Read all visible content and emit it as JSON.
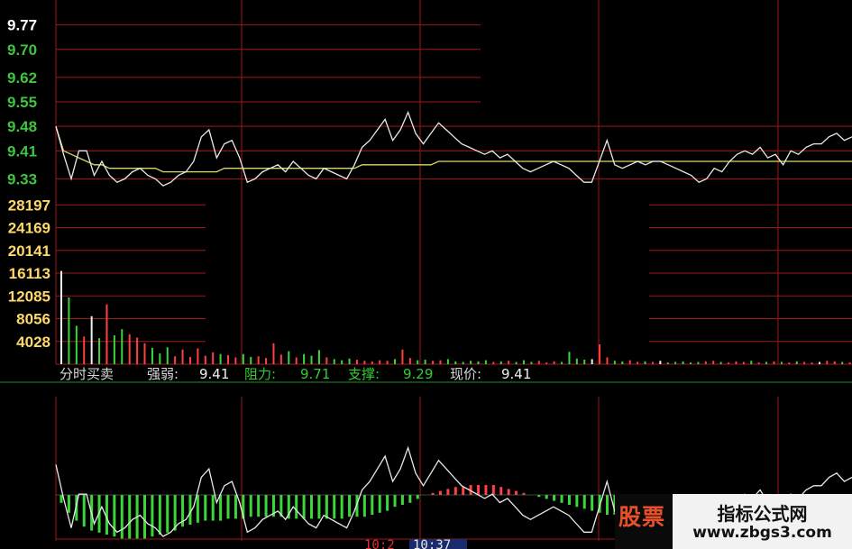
{
  "chart_data": {
    "type": "line",
    "price_panel": {
      "ticks": [
        "9.77",
        "9.70",
        "9.62",
        "9.55",
        "9.48",
        "9.41",
        "9.33"
      ],
      "tick_values": [
        9.77,
        9.7,
        9.62,
        9.55,
        9.48,
        9.41,
        9.33
      ],
      "ylim": [
        9.3,
        9.8
      ],
      "price": [
        9.48,
        9.4,
        9.33,
        9.41,
        9.41,
        9.34,
        9.38,
        9.34,
        9.32,
        9.33,
        9.35,
        9.36,
        9.34,
        9.33,
        9.31,
        9.32,
        9.34,
        9.35,
        9.38,
        9.45,
        9.47,
        9.39,
        9.43,
        9.44,
        9.39,
        9.32,
        9.33,
        9.35,
        9.36,
        9.37,
        9.35,
        9.38,
        9.36,
        9.34,
        9.33,
        9.36,
        9.35,
        9.34,
        9.33,
        9.37,
        9.42,
        9.44,
        9.47,
        9.5,
        9.44,
        9.47,
        9.52,
        9.46,
        9.43,
        9.46,
        9.49,
        9.47,
        9.45,
        9.43,
        9.42,
        9.41,
        9.4,
        9.41,
        9.39,
        9.4,
        9.38,
        9.36,
        9.35,
        9.36,
        9.37,
        9.38,
        9.37,
        9.36,
        9.34,
        9.32,
        9.32,
        9.38,
        9.44,
        9.37,
        9.36,
        9.37,
        9.38,
        9.37,
        9.38,
        9.38,
        9.37,
        9.36,
        9.35,
        9.34,
        9.32,
        9.33,
        9.36,
        9.35,
        9.38,
        9.4,
        9.41,
        9.4,
        9.42,
        9.39,
        9.4,
        9.37,
        9.41,
        9.4,
        9.42,
        9.43,
        9.43,
        9.45,
        9.46,
        9.44,
        9.45
      ],
      "avg": [
        9.48,
        9.41,
        9.4,
        9.39,
        9.38,
        9.37,
        9.37,
        9.36,
        9.36,
        9.36,
        9.36,
        9.36,
        9.36,
        9.36,
        9.35,
        9.35,
        9.35,
        9.35,
        9.35,
        9.35,
        9.35,
        9.35,
        9.36,
        9.36,
        9.36,
        9.36,
        9.36,
        9.36,
        9.36,
        9.36,
        9.36,
        9.36,
        9.36,
        9.36,
        9.36,
        9.36,
        9.36,
        9.36,
        9.36,
        9.36,
        9.37,
        9.37,
        9.37,
        9.37,
        9.37,
        9.37,
        9.37,
        9.37,
        9.37,
        9.37,
        9.38,
        9.38,
        9.38,
        9.38,
        9.38,
        9.38,
        9.38,
        9.38,
        9.38,
        9.38,
        9.38,
        9.38,
        9.38,
        9.38,
        9.38,
        9.38,
        9.38,
        9.38,
        9.38,
        9.38,
        9.38,
        9.38,
        9.38,
        9.38,
        9.38,
        9.38,
        9.38,
        9.38,
        9.38,
        9.38,
        9.38,
        9.38,
        9.38,
        9.38,
        9.38,
        9.38,
        9.38,
        9.38,
        9.38,
        9.38,
        9.38,
        9.38,
        9.38,
        9.38,
        9.38,
        9.38,
        9.38,
        9.38,
        9.38,
        9.38,
        9.38,
        9.38,
        9.38,
        9.38,
        9.38
      ]
    },
    "volume_panel": {
      "ticks": [
        "28197",
        "24169",
        "20141",
        "16113",
        "12085",
        "8056",
        "4028"
      ],
      "tick_values": [
        28197,
        24169,
        20141,
        16113,
        12085,
        8056,
        4028
      ],
      "ylim": [
        0,
        30000
      ],
      "volumes": [
        16500,
        11800,
        6800,
        4900,
        8500,
        4600,
        10600,
        5100,
        6200,
        5300,
        4700,
        3700,
        2900,
        1900,
        3000,
        1400,
        2600,
        1300,
        2800,
        1500,
        2100,
        1800,
        1600,
        1200,
        1800,
        1300,
        1400,
        1100,
        3700,
        1700,
        2300,
        1200,
        1800,
        1500,
        2500,
        1200,
        900,
        700,
        1000,
        800,
        600,
        500,
        700,
        600,
        900,
        2600,
        1100,
        700,
        800,
        600,
        700,
        900,
        500,
        400,
        600,
        500,
        700,
        400,
        500,
        600,
        400,
        700,
        400,
        600,
        300,
        500,
        400,
        2200,
        1000,
        800,
        900,
        3500,
        1200,
        600,
        500,
        700,
        400,
        500,
        400,
        600,
        300,
        400,
        500,
        300,
        400,
        500,
        600,
        400,
        300,
        500,
        400,
        600,
        300,
        400,
        500,
        400,
        300,
        500,
        400,
        300,
        400,
        600,
        500,
        400,
        300
      ]
    },
    "indicator_panel": {
      "labels": [
        {
          "text": "分时买卖",
          "color": "#d8d8d8"
        },
        {
          "text": "强弱:",
          "color": "#d8d8d8"
        },
        {
          "text": "9.41",
          "color": "#f0f0f0"
        },
        {
          "text": "阻力:",
          "color": "#33cc33"
        },
        {
          "text": "9.71",
          "color": "#33cc33"
        },
        {
          "text": "支撑:",
          "color": "#33cc33"
        },
        {
          "text": "9.29",
          "color": "#33cc33"
        },
        {
          "text": "现价:",
          "color": "#d8d8d8"
        },
        {
          "text": "9.41",
          "color": "#f0f0f0"
        }
      ],
      "histogram": [
        -4,
        -9,
        -13,
        -16,
        -18,
        -19,
        -20,
        -21,
        -22,
        -22,
        -22,
        -22,
        -21,
        -20,
        -19,
        -18,
        -16,
        -15,
        -14,
        -13,
        -13,
        -13,
        -12,
        -12,
        -12,
        -11,
        -11,
        -11,
        -11,
        -11,
        -12,
        -12,
        -12,
        -12,
        -12,
        -12,
        -12,
        -12,
        -11,
        -11,
        -11,
        -10,
        -9,
        -8,
        -6,
        -5,
        -4,
        -2,
        0,
        1,
        2,
        3,
        4,
        4,
        5,
        5,
        5,
        5,
        4,
        3,
        2,
        1,
        0,
        -1,
        -2,
        -3,
        -4,
        -5,
        -6,
        -7,
        -8,
        -9,
        -10,
        -10,
        -11,
        -11,
        -11,
        -11,
        -11,
        -11,
        -11,
        -11,
        -11,
        -11,
        -11,
        -11,
        -11,
        -11,
        -11,
        -11,
        -11,
        -11,
        -11,
        -11,
        -11,
        -11,
        -11,
        -11,
        -11,
        -11,
        -11,
        -11,
        -11,
        -11,
        -11
      ]
    },
    "time_labels": [
      "10:2",
      "10:37"
    ],
    "colors": {
      "background": "#000000",
      "grid": "#a01818",
      "price_line": "#e8e8e8",
      "avg_line": "#d9d96a",
      "up": "#ff4040",
      "down": "#3ad63a",
      "neutral": "#f0f0f0",
      "ticks_top": "#ffffff",
      "ticks_price": "#3ec43e",
      "ticks_volume": "#ffd86a",
      "current_price_tick": "#ffffff"
    }
  },
  "watermark": {
    "left_text": "股票",
    "title": "指标公式网",
    "url": "www.zbgs3.com"
  }
}
